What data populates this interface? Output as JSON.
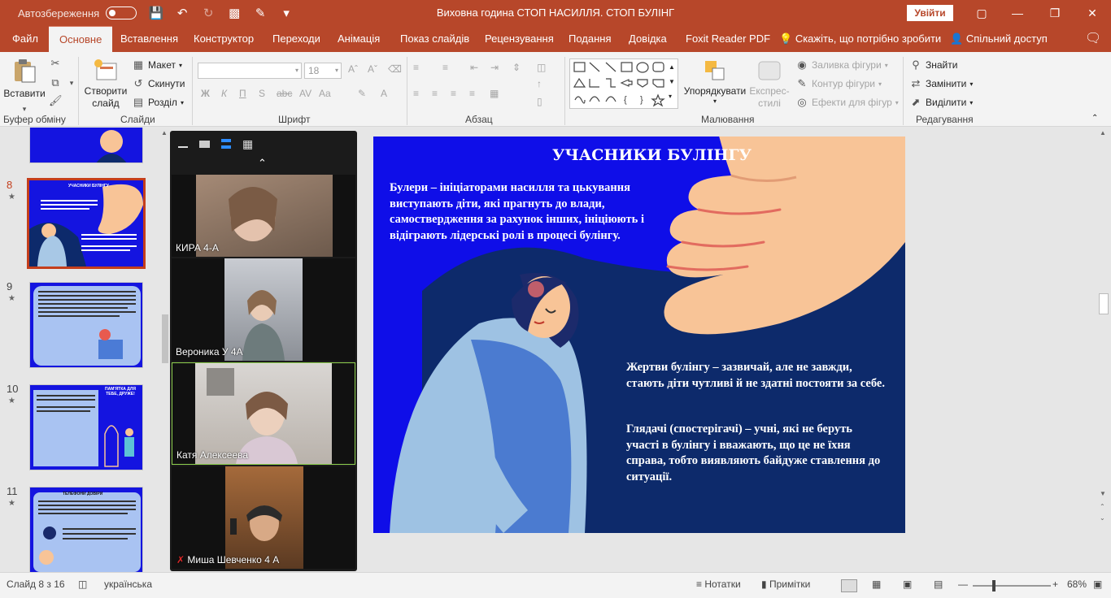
{
  "titlebar": {
    "autosave_label": "Автозбереження",
    "document_title": "Виховна година СТОП НАСИЛЛЯ. СТОП БУЛІНГ",
    "signin_label": "Увійти"
  },
  "tabs": [
    "Файл",
    "Основне",
    "Вставлення",
    "Конструктор",
    "Переходи",
    "Анімація",
    "Показ слайдів",
    "Рецензування",
    "Подання",
    "Довідка",
    "Foxit Reader PDF"
  ],
  "tell_me": "Скажіть, що потрібно зробити",
  "share_label": "Спільний доступ",
  "ribbon": {
    "paste_label": "Вставити",
    "new_slide_label_1": "Створити",
    "new_slide_label_2": "слайд",
    "layout_label": "Макет",
    "reset_label": "Скинути",
    "section_label": "Розділ",
    "font_size": "18",
    "arrange_label": "Упорядкувати",
    "quick_styles_label_1": "Експрес-",
    "quick_styles_label_2": "стилі",
    "shape_fill_label": "Заливка фігури",
    "shape_outline_label": "Контур фігури",
    "shape_effects_label": "Ефекти для фігур",
    "find_label": "Знайти",
    "replace_label": "Замінити",
    "select_label": "Виділити",
    "groups": {
      "clipboard": "Буфер обміну",
      "slides": "Слайди",
      "font": "Шрифт",
      "paragraph": "Абзац",
      "drawing": "Малювання",
      "editing": "Редагування"
    }
  },
  "thumbnails": [
    {
      "number": "8",
      "title": "УЧАСНИКИ БУЛІНГУ"
    },
    {
      "number": "9"
    },
    {
      "number": "10",
      "title": "ПАМ'ЯТКА ДЛЯ ТЕБЕ, ДРУЖЕ!"
    },
    {
      "number": "11",
      "title": "ТЕЛЕФОНИ ДОВІРИ"
    }
  ],
  "video": {
    "participants": [
      {
        "name": "КИРА 4-А"
      },
      {
        "name": "Вероника У 4А"
      },
      {
        "name": "Катя Алексеева"
      },
      {
        "name": "Миша Шевченко 4 А"
      }
    ]
  },
  "slide": {
    "title": "УЧАСНИКИ БУЛІНГУ",
    "bullies": "Булери – ініціаторами насилля та цькування виступають діти, які прагнуть до влади, самоствердження за рахунок інших, ініціюють і відіграють лідерські ролі в процесі булінгу.",
    "victims": "Жертви булінгу – зазвичай, але не завжди, стають діти чутливі й не здатні постояти за себе.",
    "bystanders": "Глядачі (спостерігачі) – учні, які не беруть участі в булінгу і вважають, що це не їхня справа, тобто виявляють байдуже ставлення до ситуації."
  },
  "statusbar": {
    "slide_counter": "Слайд 8 з 16",
    "language": "українська",
    "notes_label": "Нотатки",
    "comments_label": "Примітки",
    "zoom": "68%"
  },
  "colors": {
    "accent": "#b7472a",
    "slide_bg": "#0f0ee8",
    "slide_navy": "#0d2a6b",
    "hand": "#f8c497"
  }
}
